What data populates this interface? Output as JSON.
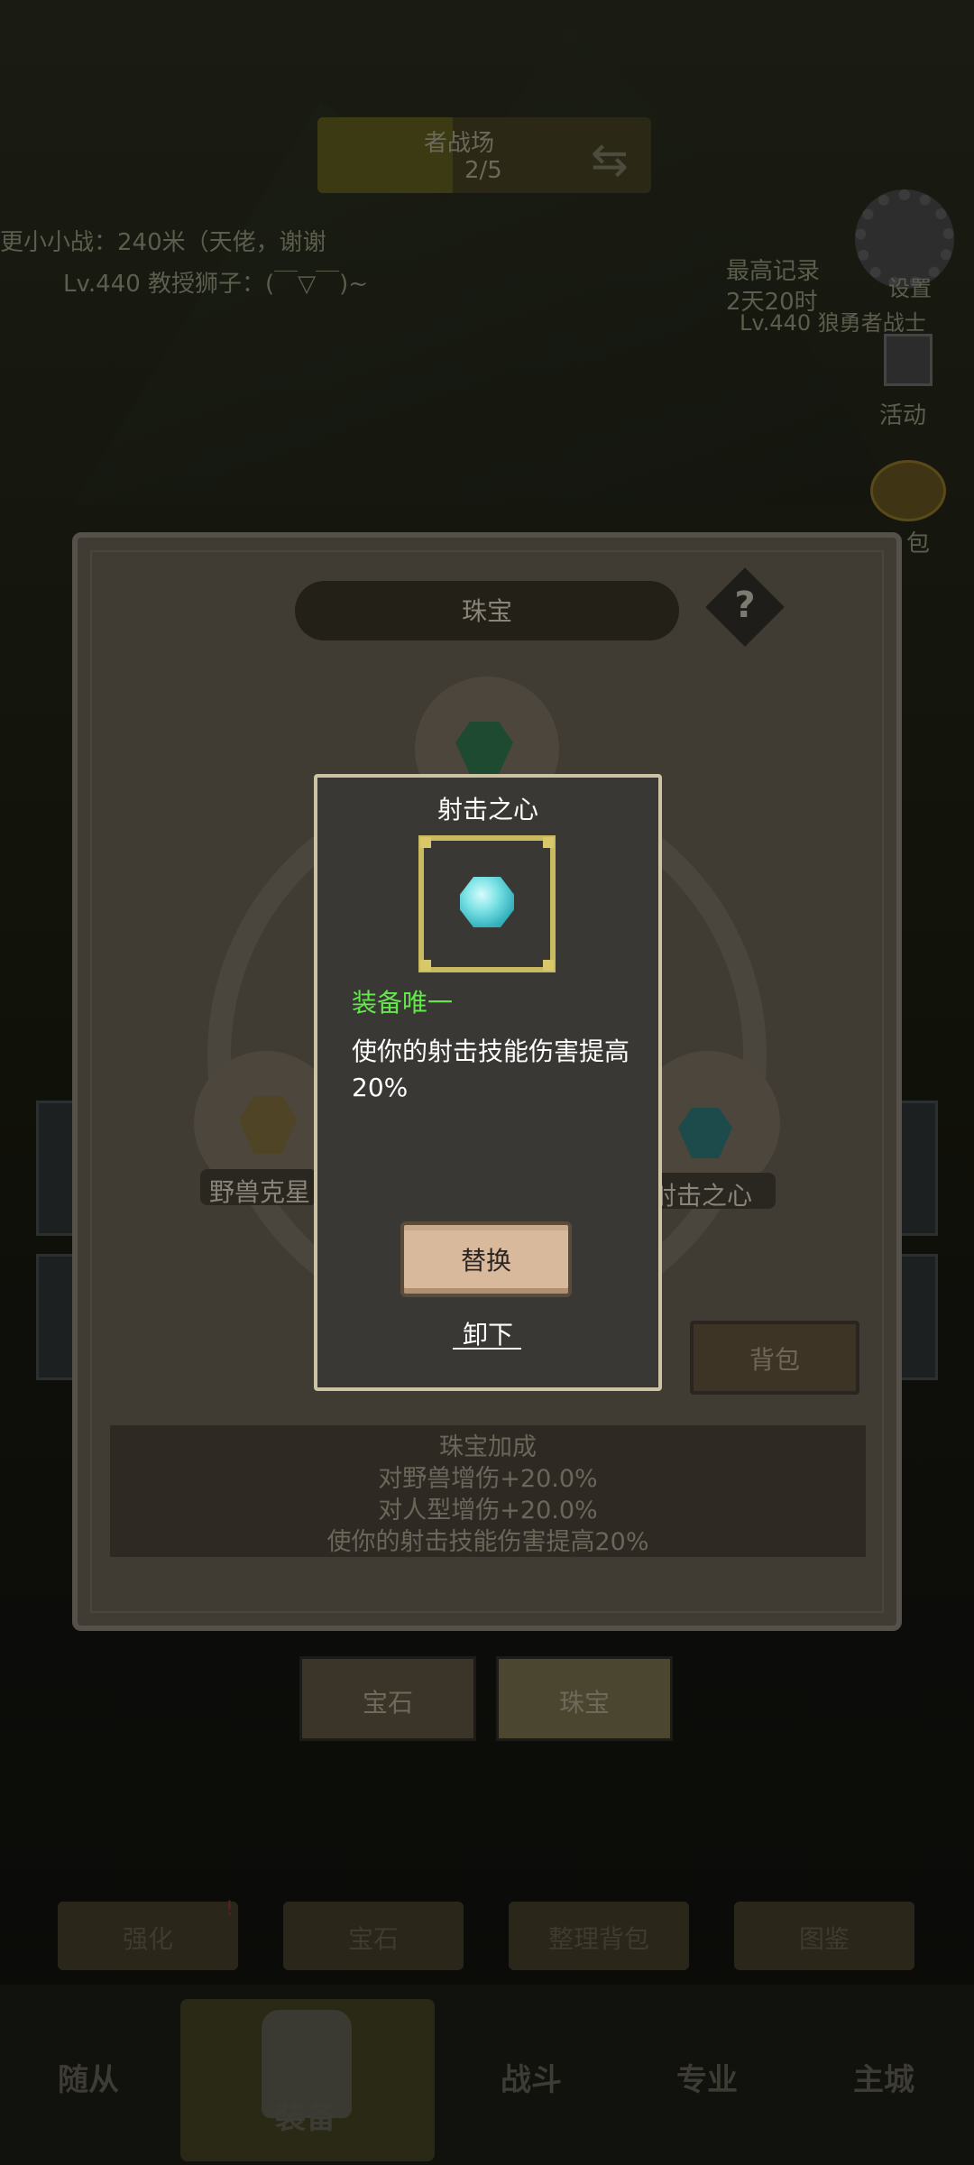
{
  "colors": {
    "accent_green": "#63e84b",
    "modal_border": "#cbc3a3",
    "gem": "#7de3e6",
    "button": "#d9b99b"
  },
  "top": {
    "banner_title": "者战场",
    "banner_count": "2/5",
    "line_a": "更小小战：240米（天佬，谢谢",
    "line_b": "Lv.440 教授狮子：(￣▽￣)~",
    "right_note": "最高记录\n2天20时",
    "right_lv": "Lv.440 狼勇者战士",
    "gear_label": "设置",
    "activity_label": "活动",
    "bag_label": "包"
  },
  "panel": {
    "title": "珠宝",
    "help": "?",
    "slot_left_label": "野兽克星",
    "slot_right_label": "射击之心",
    "bag_button": "背包",
    "bonus": [
      "珠宝加成",
      "对野兽增伤+20.0%",
      "对人型增伤+20.0%",
      "使你的射击技能伤害提高20%"
    ]
  },
  "tabs": [
    {
      "label": "宝石"
    },
    {
      "label": "珠宝"
    }
  ],
  "actions": [
    {
      "label": "强化"
    },
    {
      "label": "宝石"
    },
    {
      "label": "整理背包"
    },
    {
      "label": "图鉴"
    }
  ],
  "nav": {
    "items": [
      "随从",
      "装备",
      "战斗",
      "专业",
      "主城"
    ]
  },
  "modal": {
    "title": "射击之心",
    "item_icon": "cyan-gem-icon",
    "unique": "装备唯一",
    "desc": "使你的射击技能伤害提高20%",
    "replace": "替换",
    "remove": "卸下"
  }
}
